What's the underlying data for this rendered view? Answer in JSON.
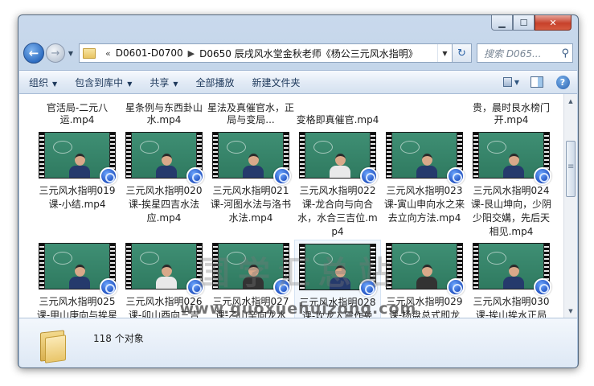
{
  "address": {
    "crumbs": [
      "D0601-D0700",
      "D0650 辰戌风水堂金秋老师《杨公三元风水指明》"
    ],
    "search_placeholder": "搜索 D065..."
  },
  "toolbar": {
    "items": [
      "组织",
      "包含到库中",
      "共享",
      "全部播放",
      "新建文件夹"
    ]
  },
  "partial_row": [
    "官活局-二元八运.mp4",
    "星条例与东西卦山水.mp4",
    "星法及真催官水，正局与变局...",
    "变格即真催官.mp4",
    "",
    "贵，晨时艮水榜门开.mp4"
  ],
  "files": [
    {
      "label": "三元风水指明019课-小结.mp4",
      "body": "blue"
    },
    {
      "label": "三元风水指明020课-挨星四吉水法应.mp4",
      "body": "blue"
    },
    {
      "label": "三元风水指明021课-河图水法与洛书水法.mp4",
      "body": "blue"
    },
    {
      "label": "三元风水指明022课-龙合向与向合水，水合三吉位.mp4",
      "body": "white"
    },
    {
      "label": "三元风水指明023课-寅山申向水之来去立向方法.mp4",
      "body": "blue"
    },
    {
      "label": "三元风水指明024课-艮山坤向，少阴少阳交媾，先后天相见.mp4",
      "body": "blue"
    },
    {
      "label": "三元风水指明025课-甲山庚向与挨星",
      "body": "blue"
    },
    {
      "label": "三元风水指明026课-卯山酉向三吉",
      "body": "white"
    },
    {
      "label": "三元风水指明027课-乙山辛向龙水",
      "body": "dark"
    },
    {
      "label": "三元风水指明028课-坎龙入震作兑",
      "body": "blue"
    },
    {
      "label": "三元风水指明029课-杨盘总式即龙",
      "body": "dark"
    },
    {
      "label": "三元风水指明030课-挨山挨水正局",
      "body": "blue"
    }
  ],
  "watermark": {
    "text": "国学汇总站",
    "url": "www.guoxuehuizong.com"
  },
  "details": {
    "count": "118 个对象"
  }
}
